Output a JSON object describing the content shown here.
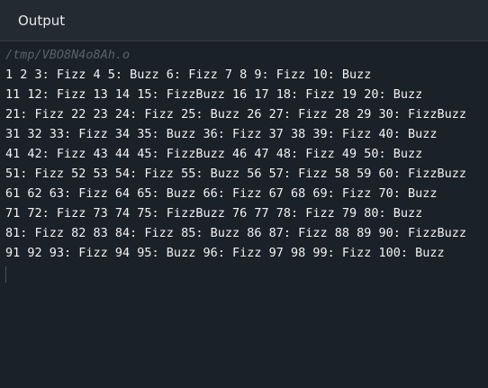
{
  "header": {
    "title": "Output"
  },
  "terminal": {
    "path": "/tmp/VBO8N4o8Ah.o",
    "lines": [
      "1 2 3: Fizz 4 5: Buzz 6: Fizz 7 8 9: Fizz 10: Buzz",
      "11 12: Fizz 13 14 15: FizzBuzz 16 17 18: Fizz 19 20: Buzz",
      "21: Fizz 22 23 24: Fizz 25: Buzz 26 27: Fizz 28 29 30: FizzBuzz",
      "31 32 33: Fizz 34 35: Buzz 36: Fizz 37 38 39: Fizz 40: Buzz",
      "41 42: Fizz 43 44 45: FizzBuzz 46 47 48: Fizz 49 50: Buzz",
      "51: Fizz 52 53 54: Fizz 55: Buzz 56 57: Fizz 58 59 60: FizzBuzz",
      "61 62 63: Fizz 64 65: Buzz 66: Fizz 67 68 69: Fizz 70: Buzz",
      "71 72: Fizz 73 74 75: FizzBuzz 76 77 78: Fizz 79 80: Buzz",
      "81: Fizz 82 83 84: Fizz 85: Buzz 86 87: Fizz 88 89 90: FizzBuzz",
      "91 92 93: Fizz 94 95: Buzz 96: Fizz 97 98 99: Fizz 100: Buzz"
    ]
  }
}
